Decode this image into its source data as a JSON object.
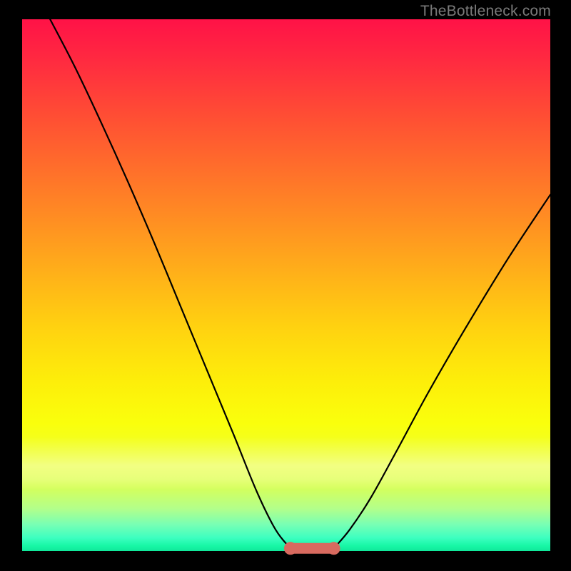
{
  "watermark": "TheBottleneck.com",
  "chart_data": {
    "type": "line",
    "title": "",
    "xlabel": "",
    "ylabel": "",
    "xlim": [
      0,
      100
    ],
    "ylim": [
      0,
      100
    ],
    "grid": false,
    "series": [
      {
        "name": "left-branch",
        "x": [
          5.3,
          10,
          15,
          20,
          25,
          30,
          35,
          40,
          44.5,
          48,
          50.8
        ],
        "y": [
          100,
          91,
          80.5,
          69.5,
          58,
          46,
          34,
          22,
          11,
          4,
          0.5
        ]
      },
      {
        "name": "right-branch",
        "x": [
          59.0,
          62,
          66,
          71,
          77,
          84,
          92,
          100
        ],
        "y": [
          0.5,
          4,
          10,
          19,
          30,
          42,
          55,
          67
        ]
      }
    ],
    "flat_segment": {
      "x0": 50.8,
      "x1": 59.0,
      "y": 0.5
    },
    "annotation": "optimal-zone"
  }
}
